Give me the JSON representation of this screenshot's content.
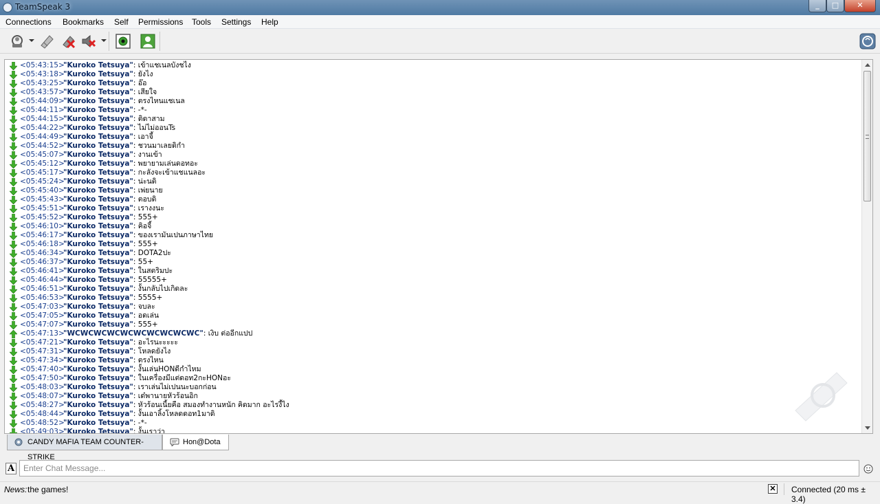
{
  "window": {
    "title": "TeamSpeak 3"
  },
  "menu": [
    "Connections",
    "Bookmarks",
    "Self",
    "Permissions",
    "Tools",
    "Settings",
    "Help"
  ],
  "toolbar": {
    "icons": [
      "connect-icon",
      "away-icon",
      "mute-microphone-icon",
      "mute-speakers-icon",
      "capture-icon",
      "subscribe-icon",
      "teamspeak-logo-icon"
    ]
  },
  "chat": {
    "nick_color": "#0c2a66",
    "lines": [
      {
        "time": "<05:43:15>",
        "nick": "\"Kuroko Tetsuya\"",
        "text": ": เข้าแชเนลบังชไง",
        "dir": "in"
      },
      {
        "time": "<05:43:18>",
        "nick": "\"Kuroko Tetsuya\"",
        "text": ": ยังไง",
        "dir": "in"
      },
      {
        "time": "<05:43:25>",
        "nick": "\"Kuroko Tetsuya\"",
        "text": ": อ๊อ",
        "dir": "in"
      },
      {
        "time": "<05:43:57>",
        "nick": "\"Kuroko Tetsuya\"",
        "text": ": เสียใจ",
        "dir": "in"
      },
      {
        "time": "<05:44:09>",
        "nick": "\"Kuroko Tetsuya\"",
        "text": ": ตรงไหนแชเนล",
        "dir": "in"
      },
      {
        "time": "<05:44:11>",
        "nick": "\"Kuroko Tetsuya\"",
        "text": ": -*-",
        "dir": "in"
      },
      {
        "time": "<05:44:15>",
        "nick": "\"Kuroko Tetsuya\"",
        "text": ": ติดาสาม",
        "dir": "in"
      },
      {
        "time": "<05:44:22>",
        "nick": "\"Kuroko Tetsuya\"",
        "text": ": ไม่ไม่ออนTs",
        "dir": "in"
      },
      {
        "time": "<05:44:49>",
        "nick": "\"Kuroko Tetsuya\"",
        "text": ": เอาจี้",
        "dir": "in"
      },
      {
        "time": "<05:44:52>",
        "nick": "\"Kuroko Tetsuya\"",
        "text": ": ชวนมาเลยดิกำ",
        "dir": "in"
      },
      {
        "time": "<05:45:07>",
        "nick": "\"Kuroko Tetsuya\"",
        "text": ": งานเข้า",
        "dir": "in"
      },
      {
        "time": "<05:45:12>",
        "nick": "\"Kuroko Tetsuya\"",
        "text": ": พยายามเล่นดอทอะ",
        "dir": "in"
      },
      {
        "time": "<05:45:17>",
        "nick": "\"Kuroko Tetsuya\"",
        "text": ": กะลังจะเข้าแชแนลอะ",
        "dir": "in"
      },
      {
        "time": "<05:45:24>",
        "nick": "\"Kuroko Tetsuya\"",
        "text": ": น่ะนดิ",
        "dir": "in"
      },
      {
        "time": "<05:45:40>",
        "nick": "\"Kuroko Tetsuya\"",
        "text": ": เพ่ยนาย",
        "dir": "in"
      },
      {
        "time": "<05:45:43>",
        "nick": "\"Kuroko Tetsuya\"",
        "text": ": ตอบดิ",
        "dir": "in"
      },
      {
        "time": "<05:45:51>",
        "nick": "\"Kuroko Tetsuya\"",
        "text": ": เรางงนะ",
        "dir": "in"
      },
      {
        "time": "<05:45:52>",
        "nick": "\"Kuroko Tetsuya\"",
        "text": ": 555+",
        "dir": "in"
      },
      {
        "time": "<05:46:10>",
        "nick": "\"Kuroko Tetsuya\"",
        "text": ": คิอจี้",
        "dir": "in"
      },
      {
        "time": "<05:46:17>",
        "nick": "\"Kuroko Tetsuya\"",
        "text": ": ของเรามันเปนภาษาไทย",
        "dir": "in"
      },
      {
        "time": "<05:46:18>",
        "nick": "\"Kuroko Tetsuya\"",
        "text": ": 555+",
        "dir": "in"
      },
      {
        "time": "<05:46:34>",
        "nick": "\"Kuroko Tetsuya\"",
        "text": ": DOTA2ปะ",
        "dir": "in"
      },
      {
        "time": "<05:46:37>",
        "nick": "\"Kuroko Tetsuya\"",
        "text": ": 55+",
        "dir": "in"
      },
      {
        "time": "<05:46:41>",
        "nick": "\"Kuroko Tetsuya\"",
        "text": ": ในสตริมปะ",
        "dir": "in"
      },
      {
        "time": "<05:46:44>",
        "nick": "\"Kuroko Tetsuya\"",
        "text": ": 55555+",
        "dir": "in"
      },
      {
        "time": "<05:46:51>",
        "nick": "\"Kuroko Tetsuya\"",
        "text": ": งั้นกลับไปเกิดละ",
        "dir": "in"
      },
      {
        "time": "<05:46:53>",
        "nick": "\"Kuroko Tetsuya\"",
        "text": ": 5555+",
        "dir": "in"
      },
      {
        "time": "<05:47:03>",
        "nick": "\"Kuroko Tetsuya\"",
        "text": ": จบละ",
        "dir": "in"
      },
      {
        "time": "<05:47:05>",
        "nick": "\"Kuroko Tetsuya\"",
        "text": ": อดเล่น",
        "dir": "in"
      },
      {
        "time": "<05:47:07>",
        "nick": "\"Kuroko Tetsuya\"",
        "text": ": 555+",
        "dir": "in"
      },
      {
        "time": "<05:47:13>",
        "nick": "\"WCWCWCWCWCWCWCWCWCWC\"",
        "text": ": เงิบ ต่ออีกแปป",
        "dir": "out"
      },
      {
        "time": "<05:47:21>",
        "nick": "\"Kuroko Tetsuya\"",
        "text": ": อะไรนะะะะะ",
        "dir": "in"
      },
      {
        "time": "<05:47:31>",
        "nick": "\"Kuroko Tetsuya\"",
        "text": ": โหลดยังไง",
        "dir": "in"
      },
      {
        "time": "<05:47:34>",
        "nick": "\"Kuroko Tetsuya\"",
        "text": ": ตรงไหน",
        "dir": "in"
      },
      {
        "time": "<05:47:40>",
        "nick": "\"Kuroko Tetsuya\"",
        "text": ": งั้นเล่นHONดีกำไหม",
        "dir": "in"
      },
      {
        "time": "<05:47:50>",
        "nick": "\"Kuroko Tetsuya\"",
        "text": ": ในเครื่องมีแต่ดอท2กะHONอะ",
        "dir": "in"
      },
      {
        "time": "<05:48:03>",
        "nick": "\"Kuroko Tetsuya\"",
        "text": ": เราเล่นไม่เปนนะบอกก่อน",
        "dir": "in"
      },
      {
        "time": "<05:48:07>",
        "nick": "\"Kuroko Tetsuya\"",
        "text": ": เด๋พานายหัวร้อนอิก",
        "dir": "in"
      },
      {
        "time": "<05:48:27>",
        "nick": "\"Kuroko Tetsuya\"",
        "text": ": หัวร้อนเนี้ยคือ สมองทำงานหนัก คิดมาก อะไรงี้ไง",
        "dir": "in"
      },
      {
        "time": "<05:48:44>",
        "nick": "\"Kuroko Tetsuya\"",
        "text": ": งั้นเอาลิ้งโหลดดอท1มาดิ",
        "dir": "in"
      },
      {
        "time": "<05:48:52>",
        "nick": "\"Kuroko Tetsuya\"",
        "text": ": -*-",
        "dir": "in"
      },
      {
        "time": "<05:49:03>",
        "nick": "\"Kuroko Tetsuya\"",
        "text": ": งั้นเราว่า",
        "dir": "in"
      }
    ]
  },
  "tabs": [
    {
      "label": "CANDY MAFIA TEAM COUNTER-STRIKE",
      "active": false,
      "icon": "server-icon"
    },
    {
      "label": "Hon@Dota",
      "active": true,
      "icon": "channel-chat-icon"
    }
  ],
  "input": {
    "placeholder": "Enter Chat Message..."
  },
  "status": {
    "news_label": "News:",
    "news_text": "the games!",
    "connection": "Connected (20 ms ± 3.4)"
  }
}
